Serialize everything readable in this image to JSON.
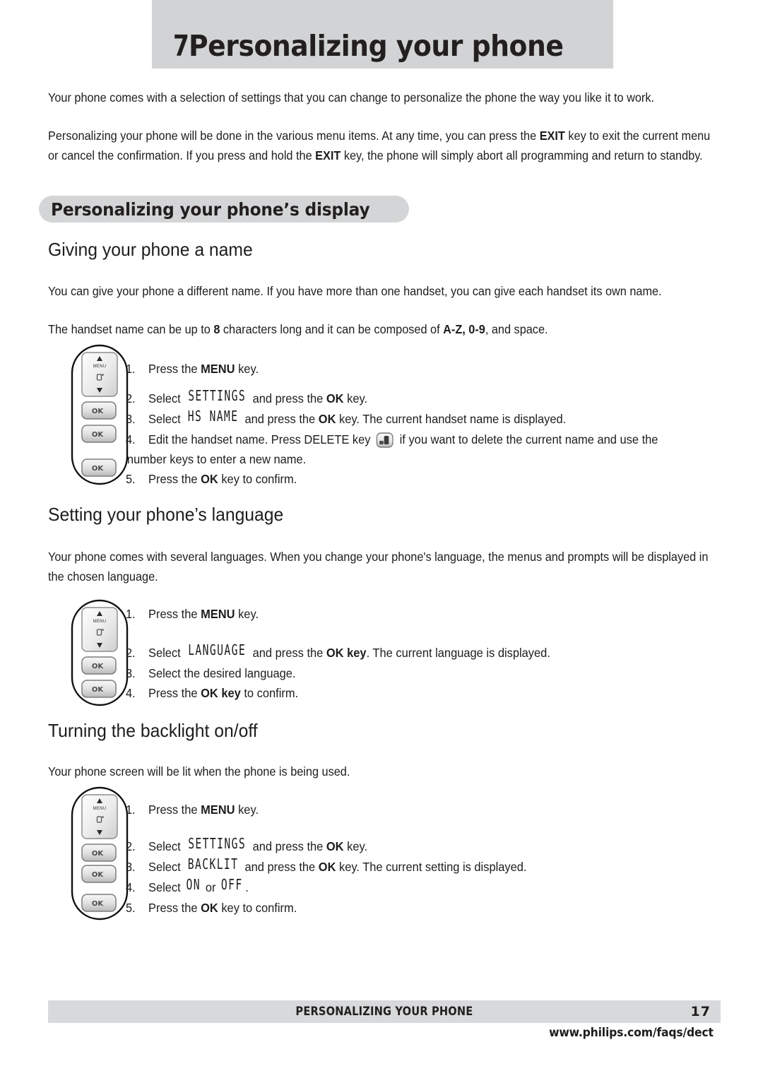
{
  "header": {
    "chapter_number": "7",
    "chapter_title": "Personalizing your phone",
    "band_color": "#d2d3d4"
  },
  "intro": {
    "paragraph_1": "Your phone comes with a selection of settings that you can change to personalize the phone the way you like it to work.",
    "paragraph_2_a": "Personalizing your phone will be done in the various menu items.  At any time, you can press the ",
    "paragraph_2_exit_1": "EXIT",
    "paragraph_2_b": " key to exit the current menu or cancel the confirmation.  If you press and hold the ",
    "paragraph_2_exit_2": "EXIT",
    "paragraph_2_c": " key, the phone will simply abort all programming and return to standby."
  },
  "section": {
    "pill_title": "Personalizing your phone’s display",
    "pill_color": "#d4d5d6"
  },
  "name_section": {
    "heading": "Giving your phone a name",
    "paragraph_1": "You can give your phone a different name.  If you have more than one handset, you can give each handset its own name.",
    "paragraph_2_a": "The handset name can be up to ",
    "paragraph_2_b": "8",
    "paragraph_2_c": " characters long and it can be composed of ",
    "paragraph_2_d": "A-Z, 0-9",
    "paragraph_2_e": ", and space.",
    "steps": [
      {
        "num": "1.",
        "pre": "Press the ",
        "bold": "MENU",
        "post": " key."
      },
      {
        "num": "2.",
        "pre": "Select ",
        "lcd": "SETTINGS",
        "mid": " and press the ",
        "bold": "OK",
        "post": " key."
      },
      {
        "num": "3.",
        "pre": "Select ",
        "lcd": "HS NAME",
        "mid": " and press the ",
        "bold": "OK",
        "post": " key.  The current handset name is displayed."
      },
      {
        "num": "4.",
        "pre": "Edit the handset name.  Press DELETE key ",
        "icon": "delete-key-icon",
        "post": " if you want to delete the current name and use the",
        "wrap": "number keys to enter a new name."
      },
      {
        "num": "5.",
        "pre": "Press the ",
        "bold": "OK",
        "post": " key to confirm."
      }
    ]
  },
  "language_section": {
    "heading": "Setting your phone’s language",
    "paragraph_1": "Your phone comes with several languages.  When you change your phone's language, the menus and prompts will be displayed in the chosen language.",
    "steps": [
      {
        "num": "1.",
        "pre": "Press the ",
        "bold": "MENU",
        "post": " key."
      },
      {
        "num": "2.",
        "pre": "Select ",
        "lcd": "LANGUAGE",
        "mid": " and press the ",
        "bold": "OK key",
        "post": ".  The current language is displayed."
      },
      {
        "num": "3.",
        "pre": "Select the desired language.",
        "bold": "",
        "post": ""
      },
      {
        "num": "4.",
        "pre": "Press the ",
        "bold": "OK key",
        "post": " to confirm."
      }
    ]
  },
  "backlight_section": {
    "heading": "Turning the backlight on/off",
    "paragraph_1": "Your phone screen will be lit when the phone is being used.",
    "steps": [
      {
        "num": "1.",
        "pre": "Press the ",
        "bold": "MENU",
        "post": " key."
      },
      {
        "num": "2.",
        "pre": "Select ",
        "lcd": "SETTINGS",
        "mid": " and press the ",
        "bold": "OK",
        "post": " key."
      },
      {
        "num": "3.",
        "pre": "Select ",
        "lcd": "BACKLIT",
        "mid": " and press the ",
        "bold": "OK",
        "post": " key.  The current setting is displayed."
      },
      {
        "num": "4.",
        "pre": "Select ",
        "lcd": "ON",
        "mid": " or ",
        "lcd2": "OFF",
        "post": "."
      },
      {
        "num": "5.",
        "pre": "Press the ",
        "bold": "OK",
        "post": " key to confirm."
      }
    ]
  },
  "illustrations": {
    "nav_key_label": "MENU",
    "ok_key_label": "OK",
    "ill_1_ok_count": "3",
    "ill_2_ok_count": "2",
    "ill_3_ok_count": "3"
  },
  "footer": {
    "title": "PERSONALIZING YOUR PHONE",
    "page_number": "17",
    "url": "www.philips.com/faqs/dect",
    "band_color": "#d8d9da"
  }
}
